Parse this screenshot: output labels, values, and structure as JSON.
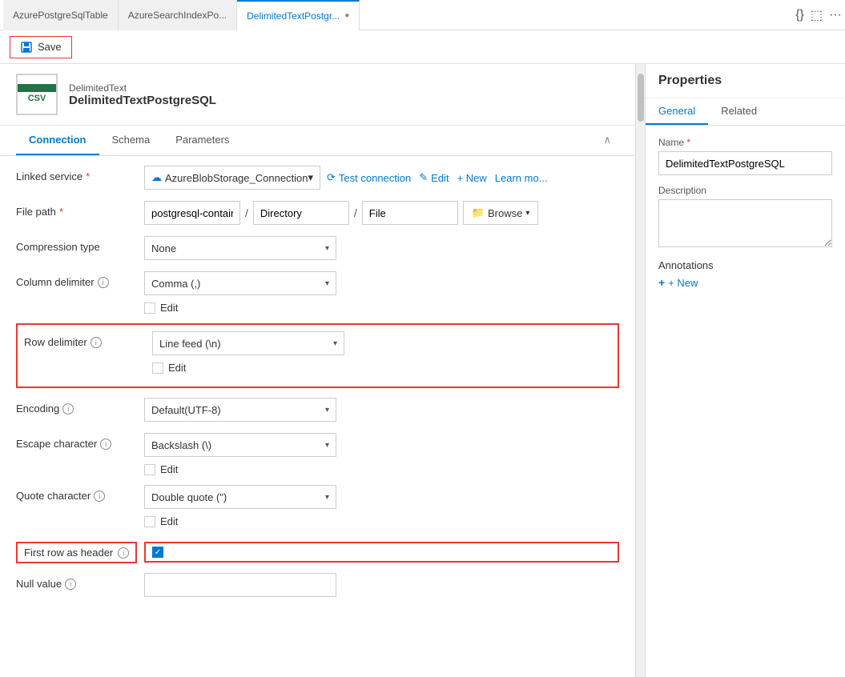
{
  "tabBar": {
    "tabs": [
      {
        "id": "tab-postgres-table",
        "label": "AzurePostgreSqlTable",
        "active": false
      },
      {
        "id": "tab-search-index",
        "label": "AzureSearchIndexPo...",
        "active": false
      },
      {
        "id": "tab-delimited",
        "label": "DelimitedTextPostgr...",
        "active": true,
        "modified": true
      }
    ],
    "actions": [
      "{}",
      "⬜",
      "···"
    ]
  },
  "toolbar": {
    "save_label": "Save"
  },
  "datasetHeader": {
    "type": "DelimitedText",
    "name": "DelimitedTextPostgreSQL"
  },
  "navTabs": [
    {
      "id": "tab-connection",
      "label": "Connection",
      "active": true
    },
    {
      "id": "tab-schema",
      "label": "Schema",
      "active": false
    },
    {
      "id": "tab-parameters",
      "label": "Parameters",
      "active": false
    }
  ],
  "form": {
    "linkedService": {
      "label": "Linked service",
      "required": true,
      "value": "AzureBlobStorage_Connection",
      "actions": [
        "Test connection",
        "Edit",
        "+ New",
        "Learn mo..."
      ]
    },
    "filePath": {
      "label": "File path",
      "required": true,
      "container": "postgresql-container",
      "directory": "Directory",
      "file": "File",
      "browseLabel": "Browse"
    },
    "compressionType": {
      "label": "Compression type",
      "value": "None"
    },
    "columnDelimiter": {
      "label": "Column delimiter",
      "info": true,
      "value": "Comma (,)",
      "editLabel": "Edit"
    },
    "rowDelimiter": {
      "label": "Row delimiter",
      "info": true,
      "value": "Line feed (\\n)",
      "editLabel": "Edit",
      "highlighted": true
    },
    "encoding": {
      "label": "Encoding",
      "info": true,
      "value": "Default(UTF-8)"
    },
    "escapeCharacter": {
      "label": "Escape character",
      "info": true,
      "value": "Backslash (\\)",
      "editLabel": "Edit"
    },
    "quoteCharacter": {
      "label": "Quote character",
      "info": true,
      "value": "Double quote (\")",
      "editLabel": "Edit"
    },
    "firstRowAsHeader": {
      "label": "First row as header",
      "info": true,
      "checked": true,
      "highlighted": true
    },
    "nullValue": {
      "label": "Null value",
      "info": true,
      "value": ""
    }
  },
  "properties": {
    "title": "Properties",
    "tabs": [
      {
        "id": "tab-general",
        "label": "General",
        "active": true
      },
      {
        "id": "tab-related",
        "label": "Related",
        "active": false
      }
    ],
    "name": {
      "label": "Name",
      "required": true,
      "value": "DelimitedTextPostgreSQL"
    },
    "description": {
      "label": "Description",
      "value": ""
    },
    "annotations": {
      "label": "Annotations",
      "addLabel": "+ New"
    }
  }
}
